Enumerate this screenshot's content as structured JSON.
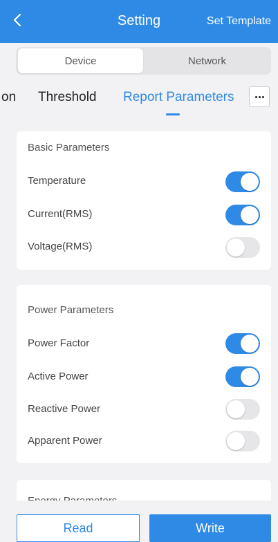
{
  "header": {
    "title": "Setting",
    "right_action": "Set Template",
    "accent_color": "#2f8ae6"
  },
  "segment": {
    "items": [
      "Device",
      "Network"
    ],
    "active": "Device"
  },
  "tabs": {
    "items": [
      "on",
      "Threshold",
      "Report Parameters"
    ],
    "active": "Report Parameters",
    "more_icon": "more-dots-icon"
  },
  "basic": {
    "title": "Basic Parameters",
    "rows": [
      {
        "label": "Temperature",
        "enabled": true
      },
      {
        "label": "Current(RMS)",
        "enabled": true
      },
      {
        "label": "Voltage(RMS)",
        "enabled": false
      }
    ]
  },
  "power": {
    "title": "Power Parameters",
    "rows": [
      {
        "label": "Power Factor",
        "enabled": true
      },
      {
        "label": "Active Power",
        "enabled": true
      },
      {
        "label": "Reactive Power",
        "enabled": false
      },
      {
        "label": "Apparent Power",
        "enabled": false
      }
    ]
  },
  "energy": {
    "title": "Energy Parameters"
  },
  "footer": {
    "read_label": "Read",
    "write_label": "Write"
  }
}
